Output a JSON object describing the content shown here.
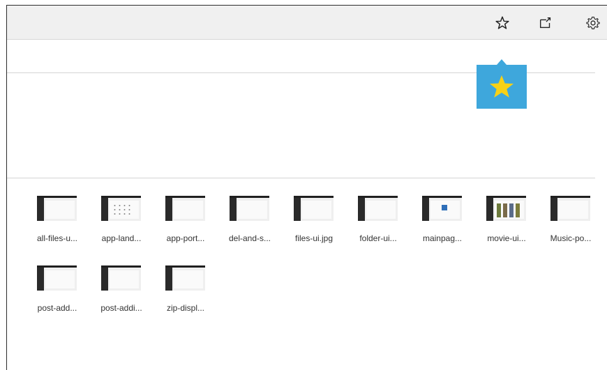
{
  "toolbar": {
    "favorite_icon": "star-outline-icon",
    "share_icon": "share-icon",
    "settings_icon": "gear-icon"
  },
  "callout": {
    "icon": "star-filled-icon",
    "background": "#3ea7dc",
    "star_color": "#f7d117"
  },
  "files": [
    {
      "name": "all-files-u...",
      "thumb": "dark-ui"
    },
    {
      "name": "app-land...",
      "thumb": "grid-ui"
    },
    {
      "name": "app-port...",
      "thumb": "light-ui"
    },
    {
      "name": "del-and-s...",
      "thumb": "dark-ui"
    },
    {
      "name": "files-ui.jpg",
      "thumb": "light-ui"
    },
    {
      "name": "folder-ui...",
      "thumb": "dark-ui"
    },
    {
      "name": "mainpag...",
      "thumb": "blue-ui"
    },
    {
      "name": "movie-ui...",
      "thumb": "pics-ui"
    },
    {
      "name": "Music-po...",
      "thumb": "dark-ui"
    },
    {
      "name": "post-add...",
      "thumb": "dark-ui"
    },
    {
      "name": "post-addi...",
      "thumb": "dark-ui"
    },
    {
      "name": "zip-displ...",
      "thumb": "light-ui"
    }
  ]
}
